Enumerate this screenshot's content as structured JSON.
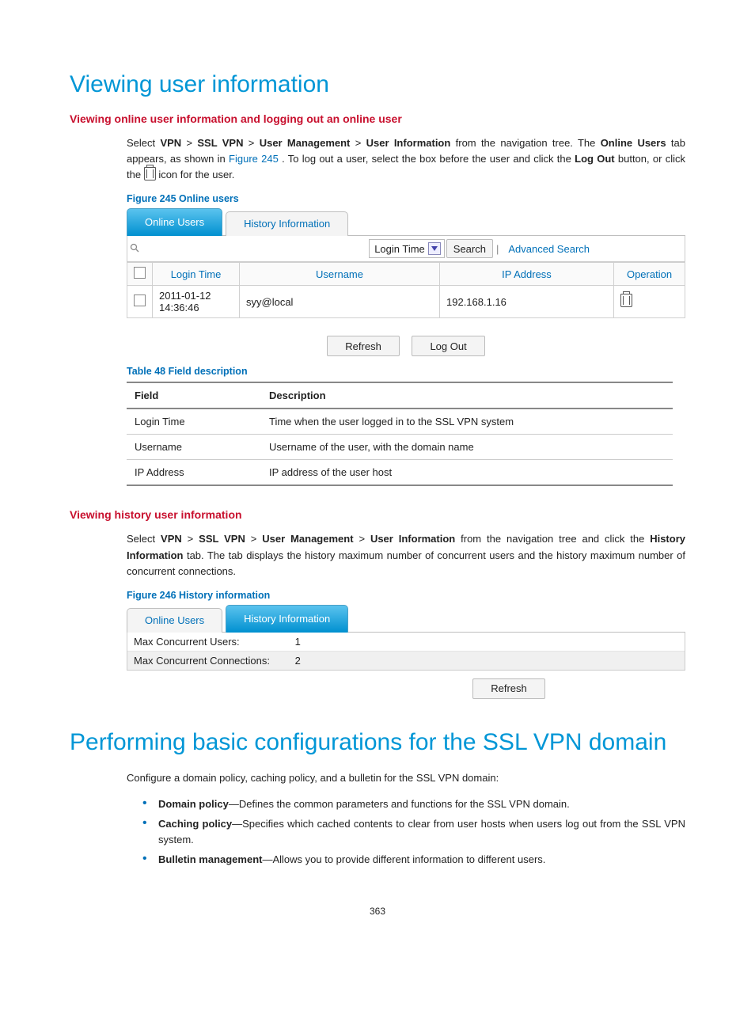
{
  "headings": {
    "h1a": "Viewing user information",
    "h2a": "Viewing online user information and logging out an online user",
    "h2b": "Viewing history user information",
    "h1b": "Performing basic configurations for the SSL VPN domain"
  },
  "para": {
    "p1_a": "Select ",
    "p1_vpn": "VPN",
    "gt": " > ",
    "p1_ssl": "SSL VPN",
    "p1_um": "User Management",
    "p1_ui": "User Information",
    "p1_b": " from the navigation tree. The ",
    "p1_ou": "Online Users",
    "p1_c": " tab appears, as shown in ",
    "p1_fig": "Figure 245",
    "p1_d": ". To log out a user, select the box before the user and click the ",
    "p1_lo": "Log Out",
    "p1_e": " button, or click the ",
    "p1_f": " icon for the user.",
    "p2_a": "Select ",
    "p2_b": " from the navigation tree and click the ",
    "p2_hi": "History Information",
    "p2_c": " tab. The tab displays the history maximum number of concurrent users and the history maximum number of concurrent connections.",
    "p3": "Configure a domain policy, caching policy, and a bulletin for the SSL VPN domain:"
  },
  "fig245": {
    "caption": "Figure 245 Online users",
    "tabs": {
      "online": "Online Users",
      "history": "History Information"
    },
    "search": {
      "dropdown": "Login Time",
      "button": "Search",
      "advanced": "Advanced Search"
    },
    "cols": {
      "chk": "",
      "login": "Login Time",
      "user": "Username",
      "ip": "IP Address",
      "op": "Operation"
    },
    "row": {
      "login": "2011-01-12 14:36:46",
      "user": "syy@local",
      "ip": "192.168.1.16"
    },
    "buttons": {
      "refresh": "Refresh",
      "logout": "Log Out"
    }
  },
  "table48": {
    "caption": "Table 48 Field description",
    "head": {
      "field": "Field",
      "desc": "Description"
    },
    "rows": [
      {
        "field": "Login Time",
        "desc": "Time when the user logged in to the SSL VPN system"
      },
      {
        "field": "Username",
        "desc": "Username of the user, with the domain name"
      },
      {
        "field": "IP Address",
        "desc": "IP address of the user host"
      }
    ]
  },
  "fig246": {
    "caption": "Figure 246 History information",
    "tabs": {
      "online": "Online Users",
      "history": "History Information"
    },
    "line1_label": "Max Concurrent Users:",
    "line1_value": "1",
    "line2_label": "Max Concurrent Connections:",
    "line2_value": "2",
    "refresh": "Refresh"
  },
  "bullets": [
    {
      "title": "Domain policy",
      "text": "—Defines the common parameters and functions for the SSL VPN domain."
    },
    {
      "title": "Caching policy",
      "text": "—Specifies which cached contents to clear from user hosts when users log out from the SSL VPN system."
    },
    {
      "title": "Bulletin management",
      "text": "—Allows you to provide different information to different users."
    }
  ],
  "pagenum": "363"
}
